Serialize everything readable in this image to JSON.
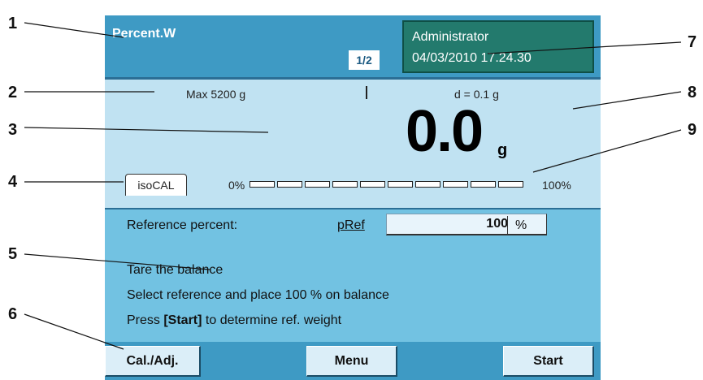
{
  "callouts": [
    "1",
    "2",
    "3",
    "4",
    "5",
    "6",
    "7",
    "8",
    "9"
  ],
  "titlebar": {
    "title": "Percent.W",
    "page_indicator": "1/2",
    "user": "Administrator",
    "datetime": "04/03/2010 17.24.30"
  },
  "weighing": {
    "max_label": "Max 5200 g",
    "d_label": "d = 0.1 g",
    "value": "0.0",
    "unit": "g",
    "isocal_label": "isoCAL",
    "bargraph_min": "0%",
    "bargraph_max": "100%",
    "bargraph_fill_fraction": 0
  },
  "info": {
    "reference_label": "Reference percent:",
    "pref_label": "pRef",
    "pref_value": "100",
    "pref_unit": "%",
    "instructions": {
      "line1": "Tare the balance",
      "line2": "Select reference and place 100 % on balance",
      "line3_prefix": "Press ",
      "line3_key": "[Start]",
      "line3_suffix": " to determine ref. weight"
    }
  },
  "softkeys": {
    "cal": "Cal./Adj.",
    "menu": "Menu",
    "start": "Start"
  },
  "colors": {
    "titlebar": "#3e9ac4",
    "user_box": "#237a6d",
    "weighing_area": "#c0e2f2",
    "info_area": "#72c2e2"
  }
}
